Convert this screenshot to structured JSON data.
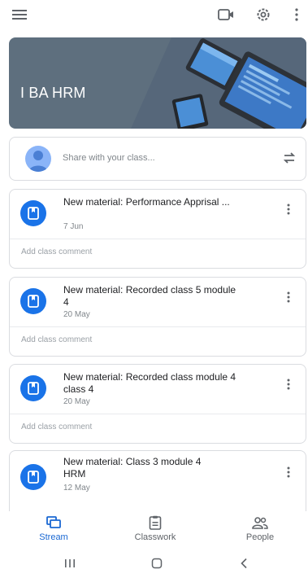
{
  "appbar": {
    "menu_icon": "hamburger-menu-icon",
    "video_icon": "video-camera-icon",
    "settings_icon": "gear-icon",
    "more_icon": "more-vert-icon"
  },
  "banner": {
    "title": "I BA HRM",
    "color": "#5e6f7e"
  },
  "share": {
    "placeholder": "Share with your class..."
  },
  "posts": [
    {
      "title": "New material: Performance Apprisal ...",
      "date": "7 Jun",
      "comment": "Add class comment"
    },
    {
      "title": "New material: Recorded class 5 module 4",
      "date": "20 May",
      "comment": "Add class comment"
    },
    {
      "title": "New material: Recorded class module 4 class 4",
      "date": "20 May",
      "comment": "Add class comment"
    },
    {
      "title": "New material: Class 3 module 4 HRM",
      "date": "12 May",
      "comment": ""
    }
  ],
  "bottom_nav": {
    "stream": "Stream",
    "classwork": "Classwork",
    "people": "People",
    "active_color": "#1967d2"
  },
  "accent": "#1a73e8"
}
